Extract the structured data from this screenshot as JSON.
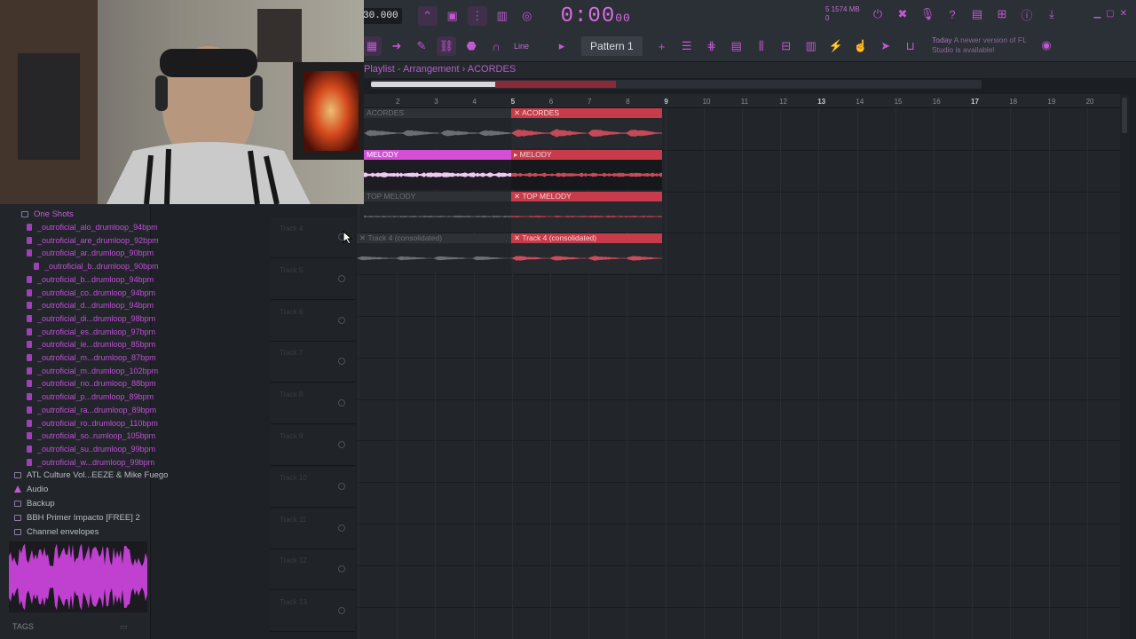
{
  "toolbar": {
    "tempo": "30.000",
    "time_main": "0:00",
    "time_sub": "00",
    "mem_top": "5   1574 MB",
    "mem_bottom": "0",
    "line_mode": "Line",
    "pattern_name": "Pattern 1",
    "news_prefix": "Today",
    "news_text": "A newer version of FL Studio is available!"
  },
  "playlist": {
    "title": "Playlist - Arrangement",
    "crumb": "ACORDES",
    "ruler": [
      "2",
      "3",
      "4",
      "5",
      "6",
      "7",
      "8",
      "9",
      "10",
      "11",
      "12",
      "13",
      "14",
      "15",
      "16",
      "17",
      "18",
      "19",
      "20"
    ]
  },
  "clips": {
    "acordes_a": "ACORDES",
    "acordes_b": "ACORDES",
    "melody_a": "MELODY",
    "melody_b": "MELODY",
    "top_a": "TOP MELODY",
    "top_b": "TOP MELODY",
    "t4_a": "Track 4 (consolidated)",
    "t4_b": "Track 4 (consolidated)"
  },
  "tracks": [
    "Track 4",
    "Track 5",
    "Track 6",
    "Track 7",
    "Track 8",
    "Track 9",
    "Track 10",
    "Track 11",
    "Track 12",
    "Track 13"
  ],
  "browser": {
    "root": "One Shots",
    "files": [
      "_outroficial_alo_drumloop_94bpm",
      "_outroficial_are_drumloop_92bpm",
      "_outroficial_ar..drumloop_90bpm",
      "_outroficial_b..drumloop_90bpm",
      "_outroficial_b...drumloop_94bpm",
      "_outroficial_co..drumloop_94bpm",
      "_outroficial_d...drumloop_94bpm",
      "_outroficial_di...drumloop_98bpm",
      "_outroficial_es..drumloop_97bpm",
      "_outroficial_ie...drumloop_85bpm",
      "_outroficial_m...drumloop_87bpm",
      "_outroficial_m..drumloop_102bpm",
      "_outroficial_no..drumloop_88bpm",
      "_outroficial_p...drumloop_89bpm",
      "_outroficial_ra...drumloop_89bpm",
      "_outroficial_ro..drumloop_110bpm",
      "_outroficial_so..rumloop_105bpm",
      "_outroficial_su..drumloop_99bpm",
      "_outroficial_w...drumloop_99bpm"
    ],
    "folders": [
      {
        "label": "ATL Culture Vol...EEZE & Mike Fuego",
        "icon": "folder-icon"
      },
      {
        "label": "Audio",
        "icon": "audio-icon"
      },
      {
        "label": "Backup",
        "icon": "folder-icon"
      },
      {
        "label": "BBH Primer Impacto [FREE]  2",
        "icon": "folder-icon"
      },
      {
        "label": "Channel envelopes",
        "icon": "folder-icon"
      }
    ],
    "tags": "TAGS"
  }
}
